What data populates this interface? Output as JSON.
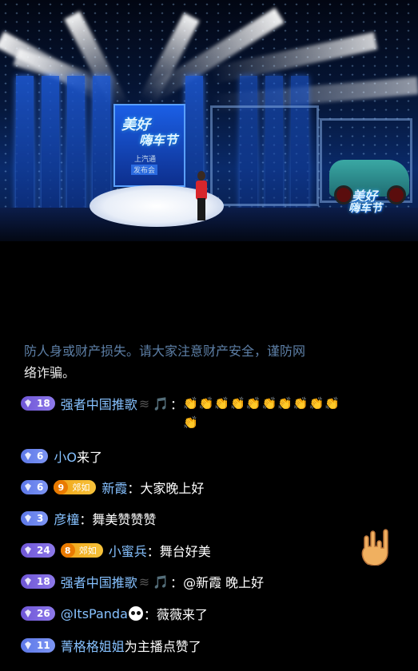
{
  "video": {
    "stage_logo_line1": "美好",
    "stage_logo_line2": "嗨车节",
    "screen_logo_line1": "美好",
    "screen_logo_line2": "嗨车节",
    "screen_subtitle1": "上汽通",
    "screen_subtitle2": "发布会"
  },
  "notice": {
    "text_grey": "防人身或财产损失。请大家注意财产安全，谨防网",
    "text_white": "络诈骗。"
  },
  "chat": [
    {
      "level": "18",
      "badge_color": "purple",
      "name": "强者中国推歌",
      "name_icons": [
        "🎵"
      ],
      "separator": "：",
      "message": "👏👏👏👏👏👏👏👏👏👏👏",
      "message_type": "claps"
    },
    {
      "level": "6",
      "badge_color": "blue",
      "name": "小O",
      "message": " 来了"
    },
    {
      "level": "6",
      "badge_color": "blue",
      "fan_level": "9",
      "fan_label": "郊如",
      "name": "新霞",
      "separator": "：",
      "message": "大家晚上好"
    },
    {
      "level": "3",
      "badge_color": "blue",
      "name": "彦橦",
      "separator": "：",
      "message": "舞美赞赞赞"
    },
    {
      "level": "24",
      "badge_color": "purple",
      "fan_level": "8",
      "fan_label": "郊如",
      "name": "小蜜兵",
      "separator": "：",
      "message": "舞台好美"
    },
    {
      "level": "18",
      "badge_color": "purple",
      "name": "强者中国推歌",
      "name_icons": [
        "🎵"
      ],
      "separator": "：",
      "message": "@新霞 晚上好"
    },
    {
      "level": "26",
      "badge_color": "purple",
      "name": "@ItsPanda",
      "separator": "：",
      "message": "薇薇来了"
    },
    {
      "level": "11",
      "badge_color": "blue",
      "name": "菁格格姐姐",
      "message": " 为主播点赞了"
    }
  ],
  "colors": {
    "name": "#86c1ff",
    "message": "#ffffff",
    "notice_grey": "#5d7fa6",
    "badge_blue": "#6f86ee",
    "badge_purple": "#7d66e0",
    "fan_badge": "#f2a81e"
  },
  "floating_icon": "rock-hand-gesture-icon"
}
